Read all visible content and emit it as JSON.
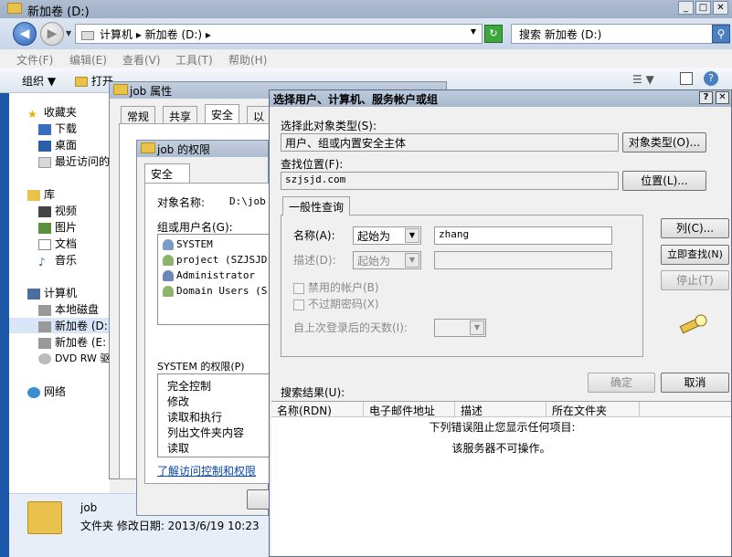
{
  "explorer": {
    "title": "新加卷 (D:)",
    "breadcrumb": "计算机 ▸ 新加卷 (D:) ▸",
    "search_placeholder": "搜索 新加卷 (D:)",
    "menus": [
      "文件(F)",
      "编辑(E)",
      "查看(V)",
      "工具(T)",
      "帮助(H)"
    ],
    "toolbar": {
      "organize": "组织 ▼",
      "open": "打开"
    },
    "nav": {
      "favorites": "收藏夹",
      "downloads": "下载",
      "desktop": "桌面",
      "recent": "最近访问的",
      "libraries": "库",
      "videos": "视频",
      "pictures": "图片",
      "documents": "文档",
      "music": "音乐",
      "computer": "计算机",
      "local_disk": "本地磁盘",
      "drive_d": "新加卷 (D:",
      "drive_e": "新加卷 (E:",
      "dvd": "DVD RW 驱动",
      "network": "网络"
    },
    "status": {
      "name": "job",
      "info": "文件夹  修改日期: 2013/6/19 10:23"
    }
  },
  "job_props": {
    "title": "job 属性",
    "tabs": [
      "常规",
      "共享",
      "安全",
      "以"
    ]
  },
  "perm_dialog": {
    "title": "job 的权限",
    "tab": "安全",
    "object_label": "对象名称:",
    "object_value": "D:\\job",
    "groups_label": "组或用户名(G):",
    "users": [
      "SYSTEM",
      "project (SZJSJD",
      "Administrator",
      "Domain Users (S"
    ],
    "perm_label": "SYSTEM 的权限(P)",
    "perms": [
      "完全控制",
      "修改",
      "读取和执行",
      "列出文件夹内容",
      "读取"
    ],
    "link": "了解访问控制和权限"
  },
  "select_dialog": {
    "title": "选择用户、计算机、服务帐户或组",
    "object_type_label": "选择此对象类型(S):",
    "object_type_value": "用户、组或内置安全主体",
    "object_type_btn": "对象类型(O)...",
    "location_label": "查找位置(F):",
    "location_value": "szjsjd.com",
    "location_btn": "位置(L)...",
    "query_tab": "一般性查询",
    "name_label": "名称(A):",
    "name_mode": "起始为",
    "name_value": "zhang",
    "desc_label": "描述(D):",
    "desc_mode": "起始为",
    "disabled_accounts": "禁用的帐户(B)",
    "no_expire": "不过期密码(X)",
    "days_label": "自上次登录后的天数(I):",
    "btn_columns": "列(C)...",
    "btn_find": "立即查找(N)",
    "btn_stop": "停止(T)",
    "btn_ok": "确定",
    "btn_cancel": "取消",
    "results_label": "搜索结果(U):",
    "columns": [
      "名称(RDN)",
      "电子邮件地址",
      "描述",
      "所在文件夹"
    ],
    "error_line1": "下列错误阻止您显示任何项目:",
    "error_line2": "该服务器不可操作。"
  }
}
